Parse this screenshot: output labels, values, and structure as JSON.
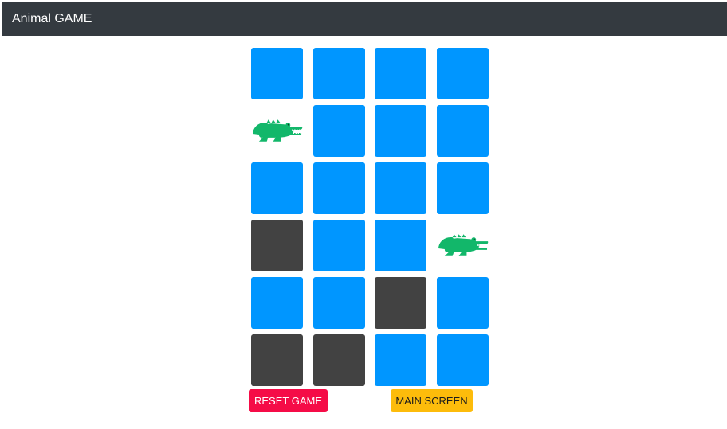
{
  "app": {
    "title": "Animal GAME"
  },
  "colors": {
    "navbar": "#343a40",
    "card_hidden": "#0096ff",
    "card_matched": "#424242",
    "reset_button": "#f50c47",
    "main_button": "#fdbc0b",
    "crocodile": "#12b76a"
  },
  "board": {
    "columns": 4,
    "rows": 6,
    "cards": [
      "hidden",
      "hidden",
      "hidden",
      "hidden",
      "crocodile",
      "hidden",
      "hidden",
      "hidden",
      "hidden",
      "hidden",
      "hidden",
      "hidden",
      "matched",
      "hidden",
      "hidden",
      "crocodile",
      "hidden",
      "hidden",
      "matched",
      "hidden",
      "matched",
      "matched",
      "hidden",
      "hidden"
    ]
  },
  "icons": {
    "crocodile": "crocodile-icon"
  },
  "buttons": {
    "reset": "RESET GAME",
    "main": "MAIN SCREEN"
  }
}
